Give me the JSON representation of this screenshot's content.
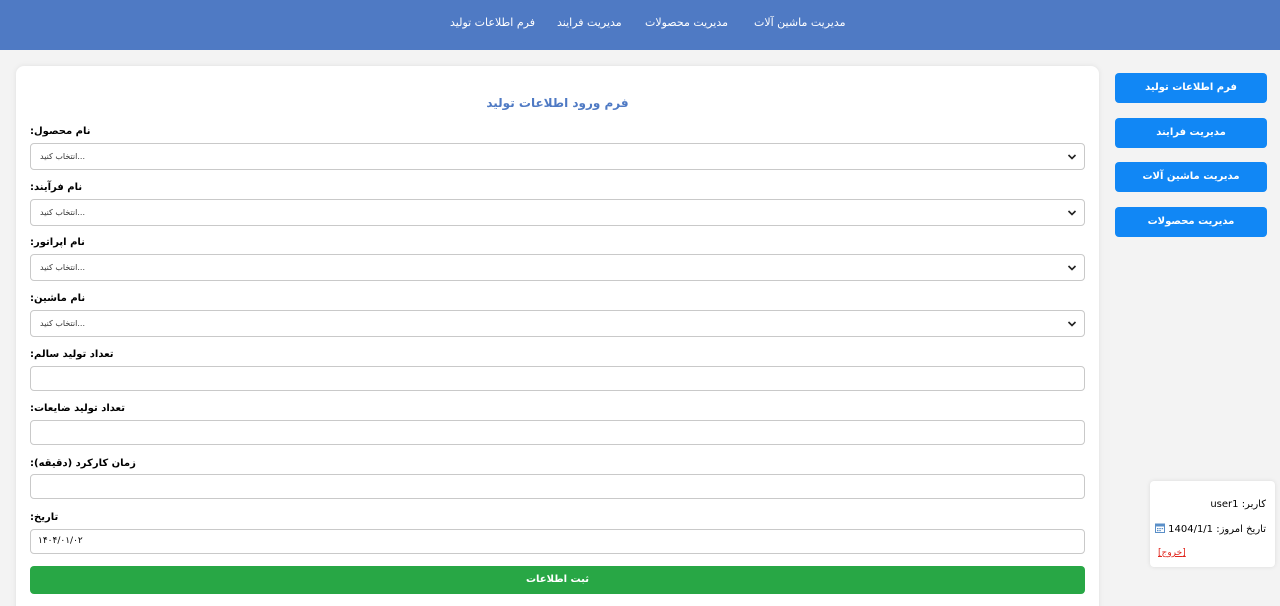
{
  "nav": {
    "items": [
      {
        "label": "مدیریت ماشین آلات"
      },
      {
        "label": "مدیریت محصولات"
      },
      {
        "label": "مدیریت فرایند"
      },
      {
        "label": "فرم اطلاعات تولید"
      }
    ]
  },
  "form": {
    "title": "فرم ورود اطلاعات تولید",
    "fields": {
      "product": {
        "label": ":نام محصول",
        "value": "انتخاب کنید..."
      },
      "process": {
        "label": ":نام فرآیند",
        "value": "انتخاب کنید..."
      },
      "operator": {
        "label": ":نام اپراتور",
        "value": "انتخاب کنید..."
      },
      "machine": {
        "label": ":نام ماشین",
        "value": "انتخاب کنید..."
      },
      "good_count": {
        "label": ":تعداد تولید سالم",
        "value": ""
      },
      "waste_count": {
        "label": ":تعداد تولید ضایعات",
        "value": ""
      },
      "work_time": {
        "label": ":زمان کارکرد (دقیقه)",
        "value": ""
      },
      "date": {
        "label": ":تاریخ",
        "value": "۱۴۰۴/۰۱/۰۲"
      }
    },
    "submit_label": "ثبت اطلاعات"
  },
  "sidebar": {
    "buttons": [
      {
        "label": "فرم اطلاعات تولید"
      },
      {
        "label": "مدیریت فرایند"
      },
      {
        "label": "مدیریت ماشین آلات"
      },
      {
        "label": "مدیریت محصولات"
      }
    ]
  },
  "user_panel": {
    "user_label": "کاربر:",
    "username": "user1",
    "date_label": "تاریخ امروز:",
    "today": "1404/1/1",
    "logout": "[خروج]",
    "icon": "calendar-icon"
  },
  "colors": {
    "nav": "#4f7ac4",
    "sidebar_button": "#1187f5",
    "submit": "#28a745",
    "logout": "#e0241b"
  }
}
